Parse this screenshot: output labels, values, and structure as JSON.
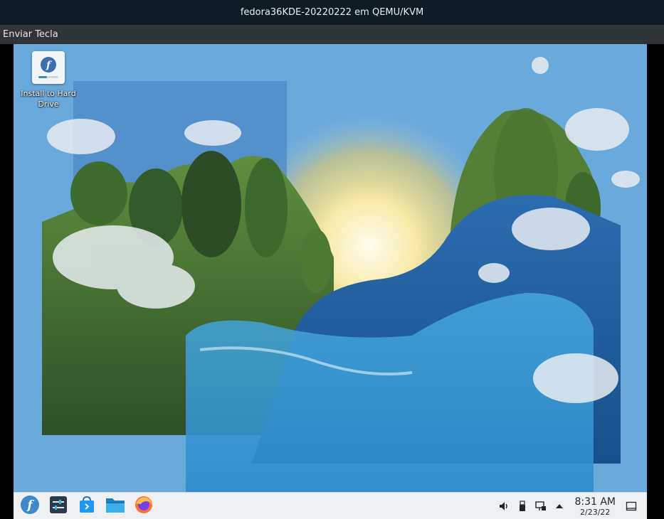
{
  "window": {
    "title": "fedora36KDE-20220222 em QEMU/KVM"
  },
  "menubar": {
    "send_key": "Enviar Tecla"
  },
  "desktop": {
    "icons": [
      {
        "label": "Install to Hard Drive",
        "icon": "fedora-installer-icon"
      }
    ]
  },
  "taskbar": {
    "launchers": [
      {
        "name": "Application Launcher",
        "icon": "fedora-logo-icon"
      },
      {
        "name": "System Settings",
        "icon": "settings-icon"
      },
      {
        "name": "Discover",
        "icon": "store-icon"
      },
      {
        "name": "Dolphin",
        "icon": "folder-icon"
      },
      {
        "name": "Firefox",
        "icon": "firefox-icon"
      }
    ],
    "tray": [
      "volume-icon",
      "usb-icon",
      "network-icon",
      "expand-arrow-icon"
    ],
    "clock": {
      "time": "8:31 AM",
      "date": "2/23/22"
    }
  },
  "colors": {
    "titlebar": "#0d1b24",
    "menubar": "#2f3437",
    "taskbar": "#eff0f1",
    "accent": "#3c8ac9"
  }
}
